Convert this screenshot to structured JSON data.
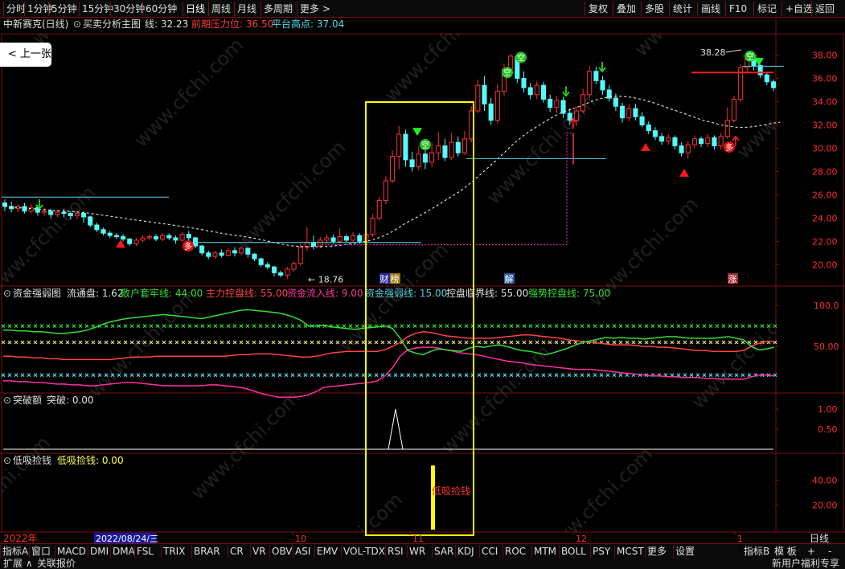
{
  "toolbar": {
    "left": [
      {
        "id": "fenshi",
        "label": "分时"
      },
      {
        "id": "1m",
        "label": "1分钟"
      },
      {
        "id": "5m",
        "label": "5分钟"
      },
      {
        "id": "15m",
        "label": "15分钟"
      },
      {
        "id": "30m",
        "label": "30分钟"
      },
      {
        "id": "60m",
        "label": "60分钟"
      },
      {
        "id": "day",
        "label": "日线",
        "active": true
      },
      {
        "id": "week",
        "label": "周线"
      },
      {
        "id": "month",
        "label": "月线"
      },
      {
        "id": "multi",
        "label": "多周期"
      },
      {
        "id": "more",
        "label": "更多 >"
      }
    ],
    "right": [
      {
        "id": "fuquan",
        "label": "复权"
      },
      {
        "id": "diejia",
        "label": "叠加"
      },
      {
        "id": "duogu",
        "label": "多股"
      },
      {
        "id": "tongji",
        "label": "统计"
      },
      {
        "id": "huaxian",
        "label": "画线"
      },
      {
        "id": "f10",
        "label": "F10"
      },
      {
        "id": "biaoji",
        "label": "标记"
      },
      {
        "id": "zixuan",
        "label": "+自选"
      },
      {
        "id": "fanhui",
        "label": "返回"
      }
    ]
  },
  "prev_button": {
    "label": "上一张",
    "icon": "chevron-left-icon"
  },
  "main_panel": {
    "stock_name": "中新赛克(日线)",
    "indicator_name": "买卖分析主图",
    "line_label": "线:",
    "line_value": "32.23",
    "pressure_label": "前期压力位:",
    "pressure_value": "36.50",
    "platform_label": "平台高点:",
    "platform_value": "37.04",
    "y_ticks": [
      "38.00",
      "36.00",
      "34.00",
      "32.00",
      "30.00",
      "28.00",
      "26.00",
      "24.00",
      "22.00",
      "20.00"
    ],
    "high_label": "38.28",
    "low_label": "18.76",
    "markers": [
      "财",
      "榜",
      "解",
      "涨"
    ],
    "buy_sign": "多",
    "sell_sign": "空"
  },
  "panel2": {
    "name": "资金强弱图",
    "items": [
      {
        "label": "流通盘:",
        "value": "1.62",
        "color": "#e0e0e0"
      },
      {
        "label": "散户套牢线:",
        "value": "44.00",
        "color": "#33dd33"
      },
      {
        "label": "主力控盘线:",
        "value": "55.00",
        "color": "#ff4444"
      },
      {
        "label": "资金流入线:",
        "value": "9.00",
        "color": "#ff3399"
      },
      {
        "label": "资金强弱线:",
        "value": "15.00",
        "color": "#55ccdd"
      },
      {
        "label": "控盘临界线:",
        "value": "55.00",
        "color": "#e0e0e0"
      },
      {
        "label": "强势控盘线:",
        "value": "75.00",
        "color": "#33dd33"
      }
    ],
    "y_ticks": [
      "100.0",
      "50.00"
    ]
  },
  "panel3": {
    "name": "突破额",
    "label": "突破:",
    "value": "0.00",
    "y_ticks": [
      "1.00",
      "0.50"
    ]
  },
  "panel4": {
    "name": "低吸捡钱",
    "label": "低吸捡钱:",
    "value": "0.00",
    "annotation": "低吸捡钱",
    "y_ticks": [
      "40.00",
      "20.00"
    ]
  },
  "time_axis": {
    "year": "2022年",
    "cursor_date": "2022/08/24/三",
    "months": [
      "10",
      "11",
      "12",
      "1"
    ],
    "period": "日线"
  },
  "bottom_tabs": [
    "指标A",
    "窗口",
    "MACD",
    "DMI",
    "DMA",
    "FSL",
    "TRIX",
    "BRAR",
    "CR",
    "VR",
    "OBV",
    "ASI",
    "EMV",
    "VOL-TDX",
    "RSI",
    "WR",
    "SAR",
    "KDJ",
    "CCI",
    "ROC",
    "MTM",
    "BOLL",
    "PSY",
    "MCST",
    "更多",
    "设置"
  ],
  "bottom_right": [
    "指标B",
    "模 板",
    "+",
    "-"
  ],
  "status_left": [
    "扩展 ∧",
    "关联报价"
  ],
  "status_right": "新用户福利专享",
  "watermark": "www.cfchi.com",
  "colors": {
    "up": "#ff3232",
    "down": "#54fcfc",
    "grid": "#7a1010",
    "axis_text": "#ff3030",
    "highlight": "#ffff00"
  },
  "chart_data": {
    "type": "candlestick",
    "price_min": 18.76,
    "price_max": 38.28,
    "y_range": [
      18.5,
      39.0
    ],
    "candles": [
      [
        25.3,
        25.0,
        25.6,
        24.6
      ],
      [
        25.0,
        24.8,
        25.4,
        24.5
      ],
      [
        24.8,
        25.0,
        25.2,
        24.5
      ],
      [
        25.0,
        24.6,
        25.3,
        24.4
      ],
      [
        24.6,
        24.9,
        25.2,
        24.4
      ],
      [
        24.9,
        24.5,
        25.1,
        24.2
      ],
      [
        24.5,
        24.6,
        24.9,
        24.2
      ],
      [
        24.6,
        24.3,
        24.8,
        24.0
      ],
      [
        24.3,
        24.5,
        24.7,
        24.1
      ],
      [
        24.5,
        24.4,
        24.8,
        24.1
      ],
      [
        24.4,
        24.2,
        24.6,
        23.9
      ],
      [
        24.2,
        24.4,
        24.6,
        23.9
      ],
      [
        24.4,
        24.1,
        24.6,
        23.6
      ],
      [
        24.1,
        23.4,
        24.2,
        23.2
      ],
      [
        23.4,
        23.0,
        23.6,
        22.8
      ],
      [
        23.0,
        22.7,
        23.2,
        22.5
      ],
      [
        22.7,
        22.5,
        22.9,
        22.3
      ],
      [
        22.5,
        22.4,
        22.7,
        22.2
      ],
      [
        22.4,
        22.2,
        22.6,
        22.0
      ],
      [
        22.2,
        21.8,
        22.3,
        21.6
      ],
      [
        21.8,
        22.1,
        22.3,
        21.6
      ],
      [
        22.1,
        22.3,
        22.5,
        21.9
      ],
      [
        22.3,
        22.4,
        22.6,
        22.1
      ],
      [
        22.4,
        22.2,
        22.6,
        22.0
      ],
      [
        22.2,
        22.5,
        22.7,
        22.0
      ],
      [
        22.5,
        22.3,
        22.7,
        22.1
      ],
      [
        22.3,
        22.1,
        22.5,
        21.8
      ],
      [
        22.1,
        22.6,
        22.8,
        21.9
      ],
      [
        22.6,
        22.3,
        22.9,
        22.0
      ],
      [
        22.3,
        21.6,
        22.4,
        21.4
      ],
      [
        21.6,
        21.0,
        21.7,
        20.8
      ],
      [
        21.0,
        20.7,
        21.2,
        20.5
      ],
      [
        20.7,
        21.0,
        21.2,
        20.5
      ],
      [
        21.0,
        20.8,
        21.3,
        20.6
      ],
      [
        20.8,
        21.2,
        21.4,
        20.7
      ],
      [
        21.2,
        21.0,
        21.5,
        20.7
      ],
      [
        21.0,
        21.4,
        21.6,
        20.8
      ],
      [
        21.4,
        20.9,
        21.5,
        20.6
      ],
      [
        20.9,
        20.5,
        21.0,
        20.3
      ],
      [
        20.5,
        20.0,
        20.6,
        19.8
      ],
      [
        20.0,
        19.8,
        20.2,
        19.6
      ],
      [
        19.8,
        19.3,
        19.9,
        19.0
      ],
      [
        19.3,
        19.1,
        19.5,
        18.9
      ],
      [
        19.1,
        19.6,
        19.8,
        18.8
      ],
      [
        19.6,
        20.1,
        20.3,
        19.4
      ],
      [
        20.1,
        21.5,
        21.8,
        19.9
      ],
      [
        21.5,
        21.9,
        23.2,
        21.2
      ],
      [
        21.9,
        21.6,
        22.5,
        21.3
      ],
      [
        21.6,
        22.1,
        22.4,
        21.4
      ],
      [
        22.1,
        22.3,
        22.6,
        21.8
      ],
      [
        22.3,
        22.0,
        22.6,
        21.8
      ],
      [
        22.0,
        22.4,
        23.1,
        21.8
      ],
      [
        22.4,
        22.1,
        22.6,
        21.9
      ],
      [
        22.1,
        22.5,
        22.8,
        21.9
      ],
      [
        22.5,
        22.0,
        22.7,
        21.8
      ],
      [
        22.0,
        22.6,
        23.6,
        21.9
      ],
      [
        22.6,
        24.0,
        24.3,
        22.4
      ],
      [
        24.0,
        25.5,
        25.8,
        23.8
      ],
      [
        25.5,
        27.2,
        27.6,
        25.2
      ],
      [
        27.2,
        29.3,
        29.8,
        27.0
      ],
      [
        29.3,
        31.2,
        31.9,
        28.2
      ],
      [
        31.2,
        29.0,
        31.6,
        28.4
      ],
      [
        29.0,
        28.4,
        29.7,
        28.0
      ],
      [
        28.4,
        29.5,
        30.2,
        28.1
      ],
      [
        29.5,
        28.8,
        30.1,
        28.2
      ],
      [
        28.8,
        29.6,
        30.5,
        28.4
      ],
      [
        29.6,
        30.2,
        31.4,
        29.0
      ],
      [
        30.2,
        29.2,
        30.8,
        28.9
      ],
      [
        29.2,
        30.5,
        31.3,
        29.0
      ],
      [
        30.5,
        29.6,
        31.0,
        29.3
      ],
      [
        29.6,
        30.8,
        31.5,
        29.4
      ],
      [
        30.8,
        33.2,
        33.6,
        30.5
      ],
      [
        33.2,
        35.4,
        35.9,
        33.0
      ],
      [
        35.4,
        33.8,
        36.2,
        33.2
      ],
      [
        33.8,
        32.4,
        34.3,
        32.0
      ],
      [
        32.4,
        34.9,
        35.5,
        32.1
      ],
      [
        34.9,
        36.8,
        37.2,
        34.5
      ],
      [
        36.8,
        37.9,
        38.1,
        36.2
      ],
      [
        37.9,
        36.0,
        38.0,
        35.6
      ],
      [
        36.0,
        35.2,
        36.6,
        34.8
      ],
      [
        35.2,
        34.6,
        35.6,
        34.2
      ],
      [
        34.6,
        35.4,
        35.8,
        34.2
      ],
      [
        35.4,
        34.2,
        35.7,
        33.9
      ],
      [
        34.2,
        33.5,
        34.6,
        33.1
      ],
      [
        33.5,
        34.1,
        34.5,
        33.0
      ],
      [
        34.1,
        33.0,
        34.4,
        32.6
      ],
      [
        33.0,
        32.4,
        33.4,
        32.0
      ],
      [
        32.4,
        33.2,
        33.6,
        31.9
      ],
      [
        33.2,
        34.6,
        35.1,
        33.0
      ],
      [
        34.6,
        36.6,
        37.1,
        34.3
      ],
      [
        36.6,
        35.8,
        37.0,
        35.5
      ],
      [
        35.8,
        35.0,
        36.2,
        34.6
      ],
      [
        35.0,
        34.3,
        35.4,
        34.0
      ],
      [
        34.3,
        33.6,
        34.7,
        33.2
      ],
      [
        33.6,
        32.6,
        33.9,
        32.2
      ],
      [
        32.6,
        33.4,
        33.8,
        32.3
      ],
      [
        33.4,
        32.7,
        33.8,
        32.4
      ],
      [
        32.7,
        32.0,
        33.1,
        31.8
      ],
      [
        32.0,
        31.5,
        32.3,
        31.2
      ],
      [
        31.5,
        31.0,
        31.8,
        30.7
      ],
      [
        31.0,
        30.6,
        31.3,
        30.3
      ],
      [
        30.6,
        30.9,
        31.2,
        30.3
      ],
      [
        30.9,
        30.2,
        31.1,
        29.9
      ],
      [
        30.2,
        29.6,
        30.5,
        29.3
      ],
      [
        29.6,
        30.3,
        30.6,
        29.1
      ],
      [
        30.3,
        30.8,
        31.1,
        30.0
      ],
      [
        30.8,
        30.4,
        31.0,
        30.1
      ],
      [
        30.4,
        30.9,
        31.2,
        30.1
      ],
      [
        30.9,
        30.2,
        31.1,
        29.9
      ],
      [
        30.2,
        31.0,
        31.3,
        29.9
      ],
      [
        31.0,
        32.4,
        33.5,
        30.8
      ],
      [
        32.4,
        34.2,
        34.5,
        32.2
      ],
      [
        34.2,
        36.9,
        37.2,
        34.0
      ],
      [
        36.9,
        38.0,
        38.3,
        36.6
      ],
      [
        38.0,
        37.1,
        38.1,
        36.7
      ],
      [
        37.1,
        36.3,
        37.2,
        36.0
      ],
      [
        36.3,
        35.7,
        36.5,
        35.4
      ],
      [
        35.7,
        35.2,
        35.9,
        34.9
      ]
    ],
    "ma": [
      25.0,
      24.95,
      24.9,
      24.85,
      24.8,
      24.76,
      24.72,
      24.68,
      24.64,
      24.6,
      24.56,
      24.52,
      24.47,
      24.4,
      24.32,
      24.24,
      24.16,
      24.08,
      24.0,
      23.9,
      23.82,
      23.75,
      23.68,
      23.6,
      23.52,
      23.44,
      23.36,
      23.28,
      23.2,
      23.1,
      23.0,
      22.9,
      22.8,
      22.7,
      22.6,
      22.52,
      22.44,
      22.36,
      22.26,
      22.14,
      22.02,
      21.9,
      21.78,
      21.68,
      21.6,
      21.56,
      21.55,
      21.54,
      21.54,
      21.56,
      21.6,
      21.66,
      21.74,
      21.82,
      21.9,
      22.0,
      22.14,
      22.32,
      22.55,
      22.84,
      23.2,
      23.55,
      23.85,
      24.15,
      24.48,
      24.8,
      25.15,
      25.5,
      25.85,
      26.2,
      26.6,
      27.05,
      27.55,
      28.05,
      28.55,
      29.05,
      29.6,
      30.15,
      30.65,
      31.1,
      31.5,
      31.85,
      32.2,
      32.55,
      32.85,
      33.1,
      33.3,
      33.5,
      33.7,
      33.95,
      34.15,
      34.3,
      34.4,
      34.45,
      34.45,
      34.4,
      34.3,
      34.18,
      34.02,
      33.85,
      33.65,
      33.45,
      33.25,
      33.05,
      32.85,
      32.65,
      32.45,
      32.3,
      32.15,
      32.0,
      31.9,
      31.82,
      31.78,
      31.8,
      31.85,
      31.95,
      32.05,
      32.15,
      32.23
    ]
  }
}
